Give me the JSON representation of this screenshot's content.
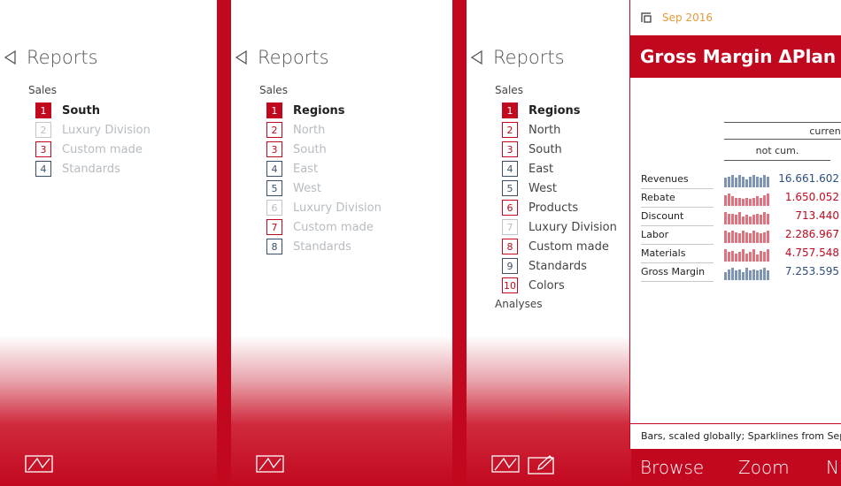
{
  "panels": [
    {
      "title": "Reports",
      "section": "Sales",
      "items": [
        {
          "num": "1",
          "label": "South",
          "style": "selected"
        },
        {
          "num": "2",
          "label": "Luxury Division",
          "style": "faded"
        },
        {
          "num": "3",
          "label": "Custom made",
          "style": "faded-red"
        },
        {
          "num": "4",
          "label": "Standards",
          "style": "faded-slate"
        }
      ]
    },
    {
      "title": "Reports",
      "section": "Sales",
      "items": [
        {
          "num": "1",
          "label": "Regions",
          "style": "selected"
        },
        {
          "num": "2",
          "label": "North",
          "style": "faded-red"
        },
        {
          "num": "3",
          "label": "South",
          "style": "faded-red"
        },
        {
          "num": "4",
          "label": "East",
          "style": "faded-slate"
        },
        {
          "num": "5",
          "label": "West",
          "style": "faded-slate"
        },
        {
          "num": "6",
          "label": "Luxury Division",
          "style": "faded"
        },
        {
          "num": "7",
          "label": "Custom made",
          "style": "faded-red"
        },
        {
          "num": "8",
          "label": "Standards",
          "style": "faded-slate"
        }
      ]
    },
    {
      "title": "Reports",
      "section": "Sales",
      "section_bottom": "Analyses",
      "items": [
        {
          "num": "1",
          "label": "Regions",
          "style": "selected"
        },
        {
          "num": "2",
          "label": "North",
          "style": "red"
        },
        {
          "num": "3",
          "label": "South",
          "style": "red"
        },
        {
          "num": "4",
          "label": "East",
          "style": "slate"
        },
        {
          "num": "5",
          "label": "West",
          "style": "slate"
        },
        {
          "num": "6",
          "label": "Products",
          "style": "red"
        },
        {
          "num": "7",
          "label": "Luxury Division",
          "style": "lightgray"
        },
        {
          "num": "8",
          "label": "Custom made",
          "style": "red"
        },
        {
          "num": "9",
          "label": "Standards",
          "style": "slate"
        },
        {
          "num": "10",
          "label": "Colors",
          "style": "red"
        }
      ]
    }
  ],
  "card": {
    "date": "Sep 2016",
    "title": "Gross Margin ΔPlan %",
    "col_current": "current",
    "col_notcum": "not cum.",
    "rows": [
      {
        "label": "Revenues",
        "value": "16.661.602",
        "color": "blue"
      },
      {
        "label": "Rebate",
        "value": "1.650.052",
        "color": "red"
      },
      {
        "label": "Discount",
        "value": "713.440",
        "color": "red"
      },
      {
        "label": "Labor",
        "value": "2.286.967",
        "color": "red"
      },
      {
        "label": "Materials",
        "value": "4.757.548",
        "color": "red"
      },
      {
        "label": "Gross Margin",
        "value": "7.253.595",
        "color": "blue"
      }
    ],
    "footer": "Bars, scaled globally; Sparklines from Sep"
  },
  "nav": {
    "browse": "Browse",
    "zoom": "Zoom",
    "next": "N"
  },
  "colors": {
    "brand_red": "#c2081f",
    "slate": "#3b5068",
    "spark_blue": "#7f93b4",
    "spark_red": "#e0727f"
  },
  "icons": [
    "back-arrow-icon",
    "chart-icon",
    "edit-icon",
    "window-icon"
  ]
}
